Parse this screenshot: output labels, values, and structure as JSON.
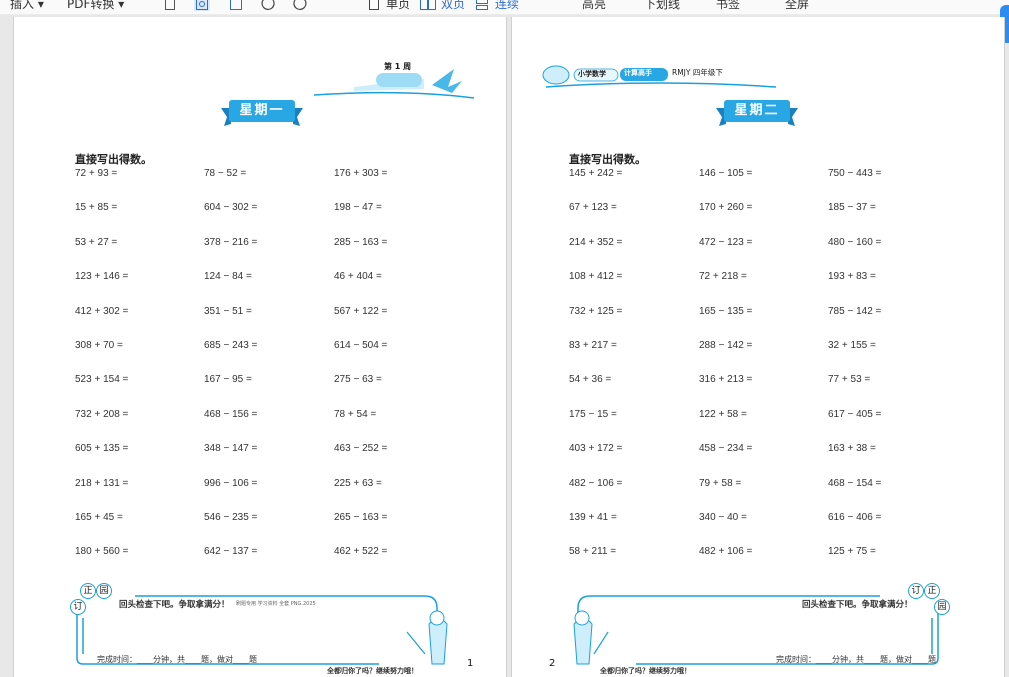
{
  "toolbar": {
    "insert": "插入",
    "pdf_convert": "PDF转换",
    "single": "单页",
    "double": "双页",
    "continuous": "连续",
    "highlight": "高亮",
    "underline": "下划线",
    "bookmark": "书签",
    "fullscreen": "全屏"
  },
  "pages": [
    {
      "week_label": "第 1 周",
      "day_title": "星期一",
      "instruction": "直接写出得数。",
      "columns": [
        [
          "72 + 93 =",
          "15 + 85 =",
          "53 + 27 =",
          "123 + 146 =",
          "412 + 302 =",
          "308 + 70 =",
          "523 + 154 =",
          "732 + 208 =",
          "605 + 135 =",
          "218 + 131 =",
          "165 + 45 =",
          "180 + 560 ="
        ],
        [
          "78 − 52 =",
          "604 − 302 =",
          "378 − 216 =",
          "124 − 84 =",
          "351 − 51 =",
          "685 − 243 =",
          "167 − 95 =",
          "468 − 156 =",
          "348 − 147 =",
          "996 − 106 =",
          "546 − 235 =",
          "642 − 137 ="
        ],
        [
          "176 + 303 =",
          "198 − 47 =",
          "285 − 163 =",
          "46 + 404 =",
          "567 + 122 =",
          "614 − 504 =",
          "275 − 63 =",
          "78 + 54 =",
          "463 − 252 =",
          "225 + 63 =",
          "265 − 163 =",
          "462 + 522 ="
        ]
      ],
      "check_text": "回头检查下吧。争取拿满分！",
      "small_note": "刷题专用 学习资料 全套 PNG.2025",
      "completion": "完成时间：____分钟，共____题，做对____题",
      "page_number": "1",
      "bottom_slogan": "全都归你了吗？继续努力哦！"
    },
    {
      "header_brand": "小学数学",
      "header_badge": "计算高手",
      "header_edition": "RMJY 四年级下",
      "day_title": "星期二",
      "instruction": "直接写出得数。",
      "columns": [
        [
          "145 + 242 =",
          "67 + 123 =",
          "214 + 352 =",
          "108 + 412 =",
          "732 + 125 =",
          "83 + 217 =",
          "54 + 36 =",
          "175 − 15 =",
          "403 + 172 =",
          "482 − 106 =",
          "139 + 41 =",
          "58 + 211 ="
        ],
        [
          "146 − 105 =",
          "170 + 260 =",
          "472 − 123 =",
          "72 + 218 =",
          "165 − 135 =",
          "288 − 142 =",
          "316 + 213 =",
          "122 + 58 =",
          "458 − 234 =",
          "79 + 58 =",
          "340 − 40 =",
          "482 + 106 ="
        ],
        [
          "750 − 443 =",
          "185 − 37 =",
          "480 − 160 =",
          "193 + 83 =",
          "785 − 142 =",
          "32 + 155 =",
          "77 + 53 =",
          "617 − 405 =",
          "163 + 38 =",
          "468 − 154 =",
          "616 − 406 =",
          "125 + 75 ="
        ]
      ],
      "check_text": "回头检查下吧。争取拿满分！",
      "completion": "完成时间：____分钟，共____题，做对____题",
      "page_number": "2",
      "bottom_slogan": "全都归你了吗？继续努力哦！"
    }
  ],
  "correction_chars": [
    "订",
    "正",
    "园"
  ],
  "colors": {
    "accent_blue": "#1aa0dc",
    "ribbon_blue": "#29a6e4",
    "link_blue": "#2b6bd8"
  }
}
